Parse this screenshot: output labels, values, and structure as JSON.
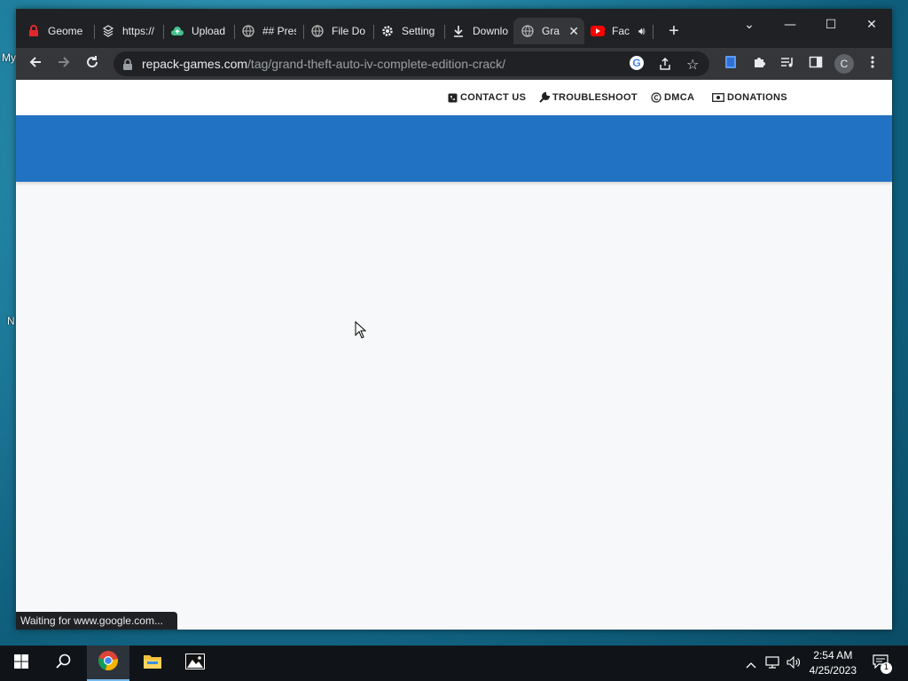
{
  "browser": {
    "tabs": [
      {
        "title": "Geome",
        "icon": "red-lock-icon"
      },
      {
        "title": "https://",
        "icon": "stack-icon"
      },
      {
        "title": "Upload",
        "icon": "cloud-upload-icon"
      },
      {
        "title": "## Pres",
        "icon": "globe-icon"
      },
      {
        "title": "File Do",
        "icon": "globe-icon"
      },
      {
        "title": "Setting",
        "icon": "gear-icon"
      },
      {
        "title": "Downlo",
        "icon": "download-icon"
      },
      {
        "title": "Gra",
        "icon": "globe-icon",
        "active": true
      },
      {
        "title": "Fac",
        "icon": "youtube-icon",
        "audio": true
      }
    ],
    "url_host": "repack-games.com",
    "url_path": "/tag/grand-theft-auto-iv-complete-edition-crack/",
    "profile_initial": "C",
    "status_text": "Waiting for www.google.com..."
  },
  "page": {
    "nav": [
      {
        "label": "CONTACT US",
        "icon": "phone-icon"
      },
      {
        "label": "TROUBLESHOOT",
        "icon": "wrench-icon"
      },
      {
        "label": "DMCA",
        "icon": "copyright-icon"
      },
      {
        "label": "DONATIONS",
        "icon": "money-icon"
      }
    ],
    "header_color": "#2272c3"
  },
  "taskbar": {
    "time": "2:54 AM",
    "date": "4/25/2023",
    "notifications": "1"
  }
}
